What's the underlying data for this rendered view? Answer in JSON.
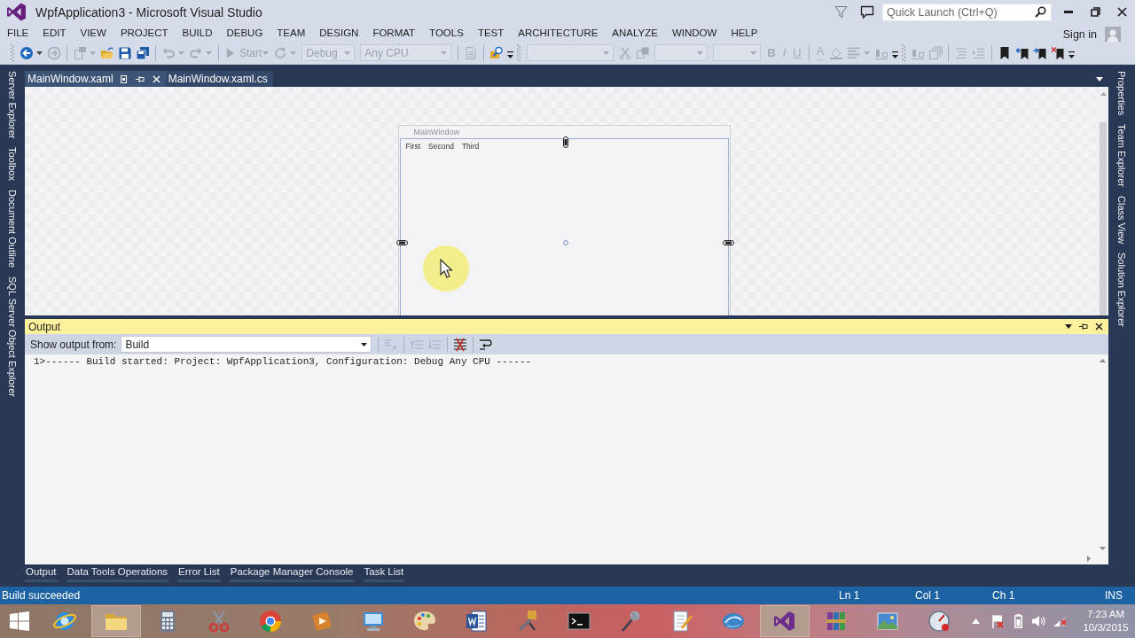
{
  "window": {
    "title": "WpfApplication3 - Microsoft Visual Studio"
  },
  "title_bar": {
    "quick_launch": {
      "placeholder": "Quick Launch (Ctrl+Q)"
    }
  },
  "menu": [
    "FILE",
    "EDIT",
    "VIEW",
    "PROJECT",
    "BUILD",
    "DEBUG",
    "TEAM",
    "DESIGN",
    "FORMAT",
    "TOOLS",
    "TEST",
    "ARCHITECTURE",
    "ANALYZE",
    "WINDOW",
    "HELP"
  ],
  "account": {
    "label": "Sign in"
  },
  "toolbar": [
    {
      "kind": "grip"
    },
    {
      "kind": "back",
      "disabled": false,
      "caret": true
    },
    {
      "kind": "forward",
      "disabled": true,
      "caret": false
    },
    {
      "kind": "separator"
    },
    {
      "kind": "new",
      "disabled": true,
      "caret": true
    },
    {
      "kind": "open",
      "disabled": false,
      "caret": false
    },
    {
      "kind": "save",
      "disabled": false,
      "caret": false
    },
    {
      "kind": "saveall",
      "disabled": false,
      "caret": false
    },
    {
      "kind": "separator"
    },
    {
      "kind": "undo",
      "disabled": true,
      "caret": true
    },
    {
      "kind": "redo",
      "disabled": true,
      "caret": true
    },
    {
      "kind": "separator"
    },
    {
      "kind": "start",
      "label": "Start",
      "disabled": true,
      "caret": true
    },
    {
      "kind": "attach",
      "disabled": true,
      "caret": true
    },
    {
      "kind": "combo",
      "value": "Debug",
      "disabled": true
    },
    {
      "kind": "combo",
      "value": "Any CPU",
      "disabled": true
    },
    {
      "kind": "separator"
    },
    {
      "kind": "page",
      "disabled": true,
      "caret": false
    },
    {
      "kind": "separator"
    },
    {
      "kind": "find",
      "disabled": false,
      "caret": false
    },
    {
      "kind": "overflow"
    },
    {
      "kind": "grip"
    },
    {
      "kind": "combo",
      "disabled": true
    },
    {
      "kind": "cut",
      "disabled": true,
      "caret": false
    },
    {
      "kind": "layers",
      "disabled": true,
      "caret": false
    },
    {
      "kind": "combo",
      "disabled": true
    },
    {
      "kind": "combo",
      "disabled": true
    },
    {
      "kind": "bold",
      "label": "B",
      "disabled": true
    },
    {
      "kind": "italic",
      "label": "I",
      "disabled": true
    },
    {
      "kind": "underline",
      "label": "U",
      "disabled": true
    },
    {
      "kind": "separator"
    },
    {
      "kind": "fontcolor",
      "label": "A",
      "disabled": true
    },
    {
      "kind": "fill",
      "disabled": true,
      "caret": false
    },
    {
      "kind": "align",
      "disabled": true,
      "caret": true
    },
    {
      "kind": "arrange",
      "disabled": true,
      "caret": false
    },
    {
      "kind": "overflow"
    },
    {
      "kind": "grip"
    },
    {
      "kind": "arrange",
      "disabled": true,
      "caret": false
    },
    {
      "kind": "stack",
      "disabled": true,
      "caret": false
    },
    {
      "kind": "separator"
    },
    {
      "kind": "list",
      "disabled": true,
      "caret": false
    },
    {
      "kind": "indent",
      "disabled": true,
      "caret": false
    },
    {
      "kind": "separator"
    },
    {
      "kind": "bookmark",
      "disabled": false,
      "caret": false
    },
    {
      "kind": "prevmark",
      "disabled": false,
      "caret": false
    },
    {
      "kind": "nextmark",
      "disabled": false,
      "caret": false
    },
    {
      "kind": "clearmark",
      "disabled": false,
      "caret": false
    },
    {
      "kind": "overflow"
    }
  ],
  "left_tool_tabs": [
    "Server Explorer",
    "Toolbox",
    "Document Outline",
    "SQL Server Object Explorer"
  ],
  "right_tool_tabs": [
    "Properties",
    "Team Explorer",
    "Class View",
    "Solution Explorer"
  ],
  "document_tabs": [
    {
      "label": "MainWindow.xaml",
      "selected": true
    },
    {
      "label": "MainWindow.xaml.cs",
      "selected": false
    }
  ],
  "designer": {
    "window_title": "MainWindow",
    "menu_items": [
      "First",
      "Second",
      "Third"
    ]
  },
  "output": {
    "title": "Output",
    "source_label": "Show output from:",
    "source": "Build",
    "toolbar": [
      {
        "kind": "separator"
      },
      {
        "kind": "gosource",
        "disabled": true
      },
      {
        "kind": "separator"
      },
      {
        "kind": "prevmsg",
        "disabled": true
      },
      {
        "kind": "nextmsg",
        "disabled": true
      },
      {
        "kind": "separator"
      },
      {
        "kind": "clearall",
        "disabled": false
      },
      {
        "kind": "separator"
      },
      {
        "kind": "wrap",
        "disabled": false
      }
    ],
    "lines": [
      "1>------ Build started: Project: WpfApplication3, Configuration: Debug Any CPU ------"
    ]
  },
  "bottom_tabs": [
    "Output",
    "Data Tools Operations",
    "Error List",
    "Package Manager Console",
    "Task List"
  ],
  "status_bar": {
    "message": "Build succeeded",
    "line": "Ln 1",
    "column": "Col 1",
    "character": "Ch 1",
    "mode": "INS"
  },
  "taskbar": {
    "apps": [
      {
        "kind": "ie",
        "active": false
      },
      {
        "kind": "folder",
        "active": true
      },
      {
        "kind": "calculator",
        "active": false
      },
      {
        "kind": "scissors",
        "active": false
      },
      {
        "kind": "chrome",
        "active": false
      },
      {
        "kind": "media",
        "active": false
      },
      {
        "kind": "monitor",
        "active": false
      },
      {
        "kind": "palette",
        "active": false
      },
      {
        "kind": "word",
        "active": false
      },
      {
        "kind": "tools",
        "active": false
      },
      {
        "kind": "terminal",
        "active": false
      },
      {
        "kind": "microphone",
        "active": false
      },
      {
        "kind": "notepad",
        "active": false
      },
      {
        "kind": "globe",
        "active": false
      },
      {
        "kind": "vs",
        "active": true
      },
      {
        "kind": "archive",
        "active": false
      },
      {
        "kind": "picture",
        "active": false
      },
      {
        "kind": "gauge",
        "active": false
      }
    ],
    "clock": {
      "time": "7:23 AM",
      "date": "10/3/2015"
    }
  }
}
